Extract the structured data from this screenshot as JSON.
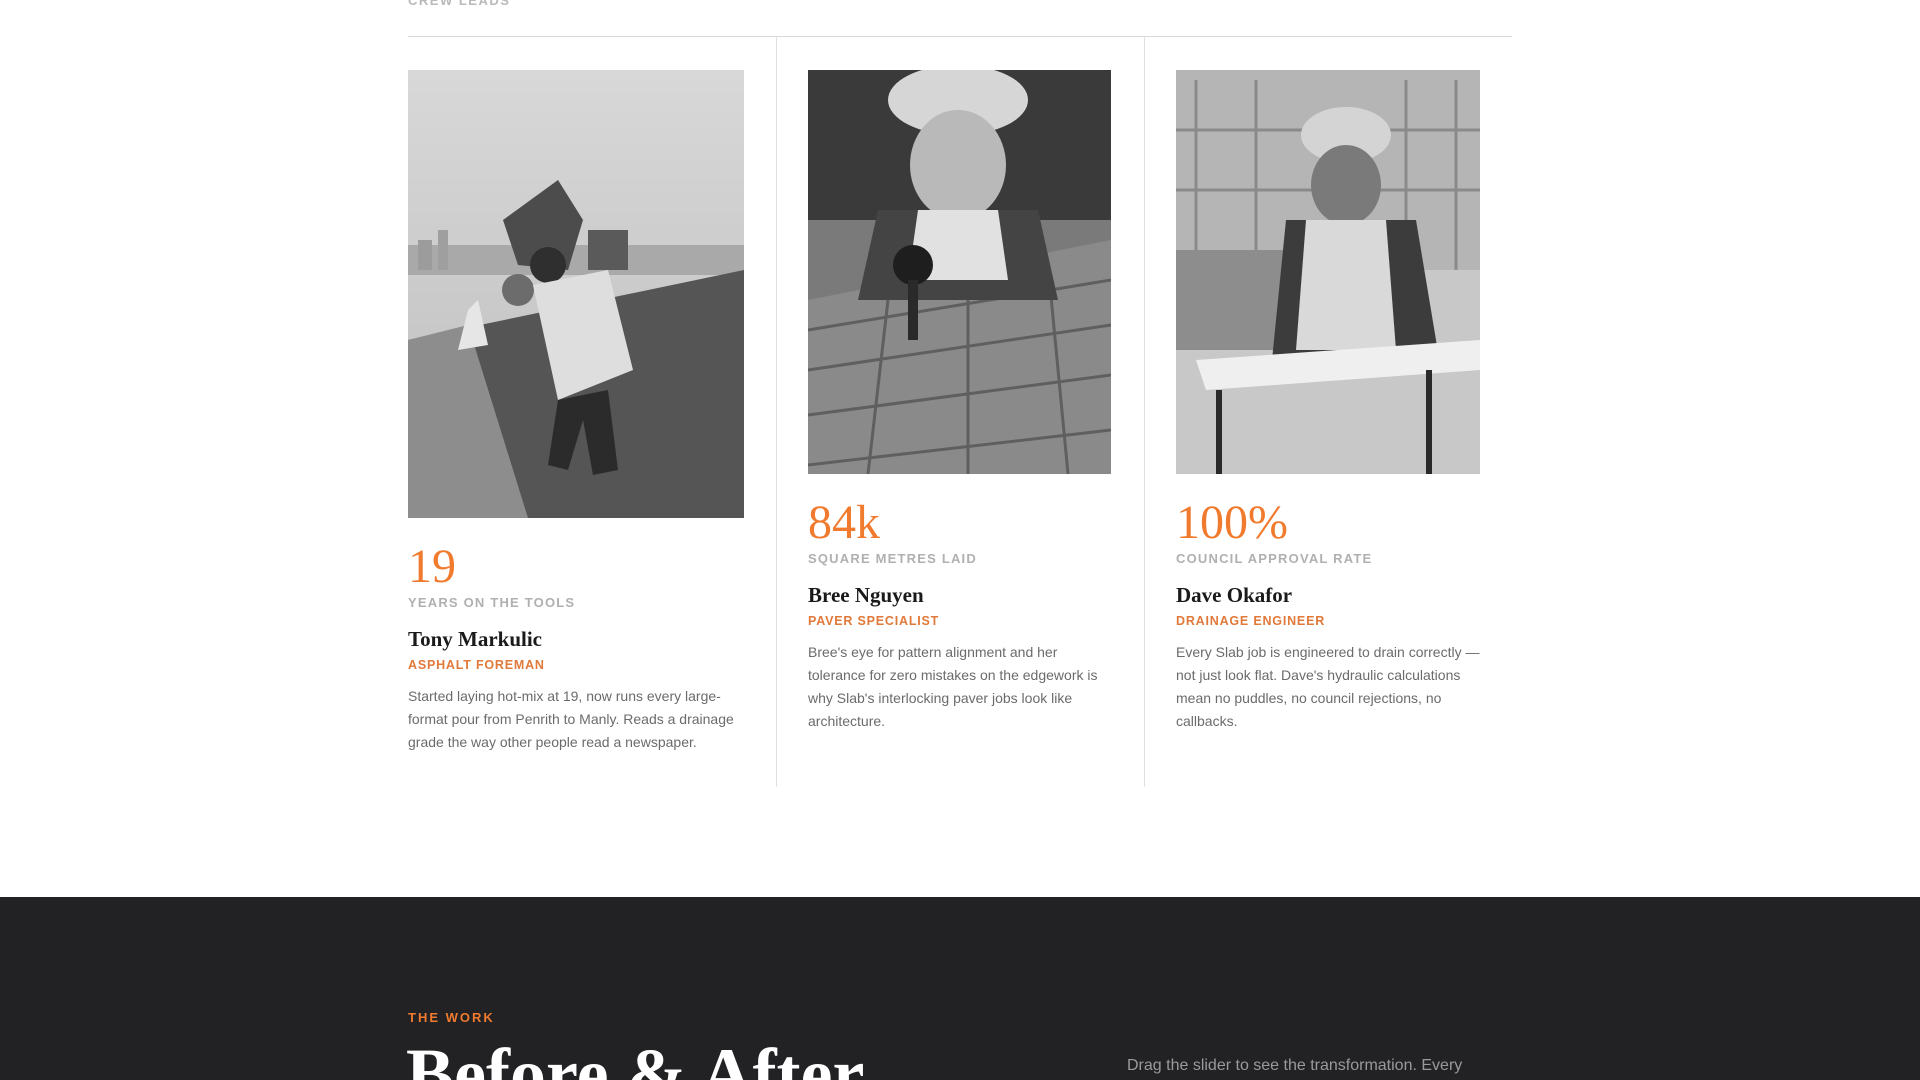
{
  "crew": {
    "eyebrow": "CREW LEADS",
    "members": [
      {
        "stat": "19",
        "stat_label": "YEARS ON THE TOOLS",
        "name": "Tony Markulic",
        "role": "ASPHALT FOREMAN",
        "bio": "Started laying hot-mix at 19, now runs every large-format pour from Penrith to Manly. Reads a drainage grade the way other people read a newspaper."
      },
      {
        "stat": "84k",
        "stat_label": "SQUARE METRES LAID",
        "name": "Bree Nguyen",
        "role": "PAVER SPECIALIST",
        "bio": "Bree's eye for pattern alignment and her tolerance for zero mistakes on the edgework is why Slab's interlocking paver jobs look like architecture."
      },
      {
        "stat": "100%",
        "stat_label": "COUNCIL APPROVAL RATE",
        "name": "Dave Okafor",
        "role": "DRAINAGE ENGINEER",
        "bio": "Every Slab job is engineered to drain correctly — not just look flat. Dave's hydraulic calculations mean no puddles, no council rejections, no callbacks."
      }
    ]
  },
  "work": {
    "eyebrow": "THE WORK",
    "title": "Before & After",
    "description": "Drag the slider to see the transformation. Every"
  },
  "colors": {
    "accent": "#f07a2e",
    "dark_section": "#222225"
  }
}
